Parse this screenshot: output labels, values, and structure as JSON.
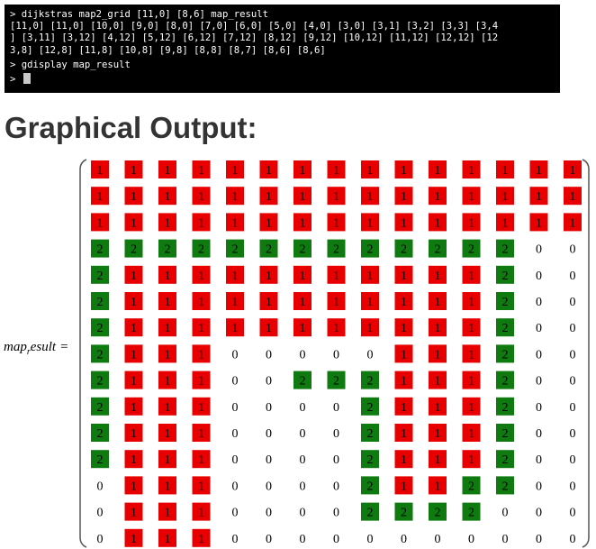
{
  "terminal": {
    "lines": [
      "> dijkstras map2_grid [11,0] [8,6] map_result",
      "[11,0] [11,0] [10,0] [9,0] [8,0] [7,0] [6,0] [5,0] [4,0] [3,0] [3,1] [3,2] [3,3] [3,4",
      "] [3,11] [3,12] [4,12] [5,12] [6,12] [7,12] [8,12] [9,12] [10,12] [11,12] [12,12] [12",
      "3,8] [12,8] [11,8] [10,8] [9,8] [8,8] [8,7] [8,6] [8,6]",
      "> gdisplay map_result",
      "> "
    ]
  },
  "heading": "Graphical Output:",
  "equation": {
    "var_main": "map",
    "var_sub": "r",
    "var_rest": "esult",
    "equals": "="
  },
  "colors": {
    "cell_1": "#e80000",
    "cell_2": "#0f7a0f",
    "text": "#000000",
    "bracket": "#555555"
  },
  "matrix_rows": [
    [
      "1",
      "1",
      "1",
      "1",
      "1",
      "1",
      "1",
      "1",
      "1",
      "1",
      "1",
      "1",
      "1",
      "1",
      "1"
    ],
    [
      "1",
      "1",
      "1",
      "1",
      "1",
      "1",
      "1",
      "1",
      "1",
      "1",
      "1",
      "1",
      "1",
      "1",
      "1"
    ],
    [
      "1",
      "1",
      "1",
      "1",
      "1",
      "1",
      "1",
      "1",
      "1",
      "1",
      "1",
      "1",
      "1",
      "1",
      "1"
    ],
    [
      "2",
      "2",
      "2",
      "2",
      "2",
      "2",
      "2",
      "2",
      "2",
      "2",
      "2",
      "2",
      "2",
      "0",
      "0"
    ],
    [
      "2",
      "1",
      "1",
      "1",
      "1",
      "1",
      "1",
      "1",
      "1",
      "1",
      "1",
      "1",
      "2",
      "0",
      "0"
    ],
    [
      "2",
      "1",
      "1",
      "1",
      "1",
      "1",
      "1",
      "1",
      "1",
      "1",
      "1",
      "1",
      "2",
      "0",
      "0"
    ],
    [
      "2",
      "1",
      "1",
      "1",
      "1",
      "1",
      "1",
      "1",
      "1",
      "1",
      "1",
      "1",
      "2",
      "0",
      "0"
    ],
    [
      "2",
      "1",
      "1",
      "1",
      "0",
      "0",
      "0",
      "0",
      "0",
      "1",
      "1",
      "1",
      "2",
      "0",
      "0"
    ],
    [
      "2",
      "1",
      "1",
      "1",
      "0",
      "0",
      "2",
      "2",
      "2",
      "1",
      "1",
      "1",
      "2",
      "0",
      "0"
    ],
    [
      "2",
      "1",
      "1",
      "1",
      "0",
      "0",
      "0",
      "0",
      "2",
      "1",
      "1",
      "1",
      "2",
      "0",
      "0"
    ],
    [
      "2",
      "1",
      "1",
      "1",
      "0",
      "0",
      "0",
      "0",
      "2",
      "1",
      "1",
      "1",
      "2",
      "0",
      "0"
    ],
    [
      "2",
      "1",
      "1",
      "1",
      "0",
      "0",
      "0",
      "0",
      "2",
      "1",
      "1",
      "1",
      "2",
      "0",
      "0"
    ],
    [
      "0",
      "1",
      "1",
      "1",
      "0",
      "0",
      "0",
      "0",
      "2",
      "1",
      "1",
      "2",
      "2",
      "0",
      "0"
    ],
    [
      "0",
      "1",
      "1",
      "1",
      "0",
      "0",
      "0",
      "0",
      "2",
      "2",
      "2",
      "2",
      "0",
      "0",
      "0"
    ],
    [
      "0",
      "1",
      "1",
      "1",
      "0",
      "0",
      "0",
      "0",
      "0",
      "0",
      "0",
      "0",
      "0",
      "0",
      "0"
    ]
  ]
}
